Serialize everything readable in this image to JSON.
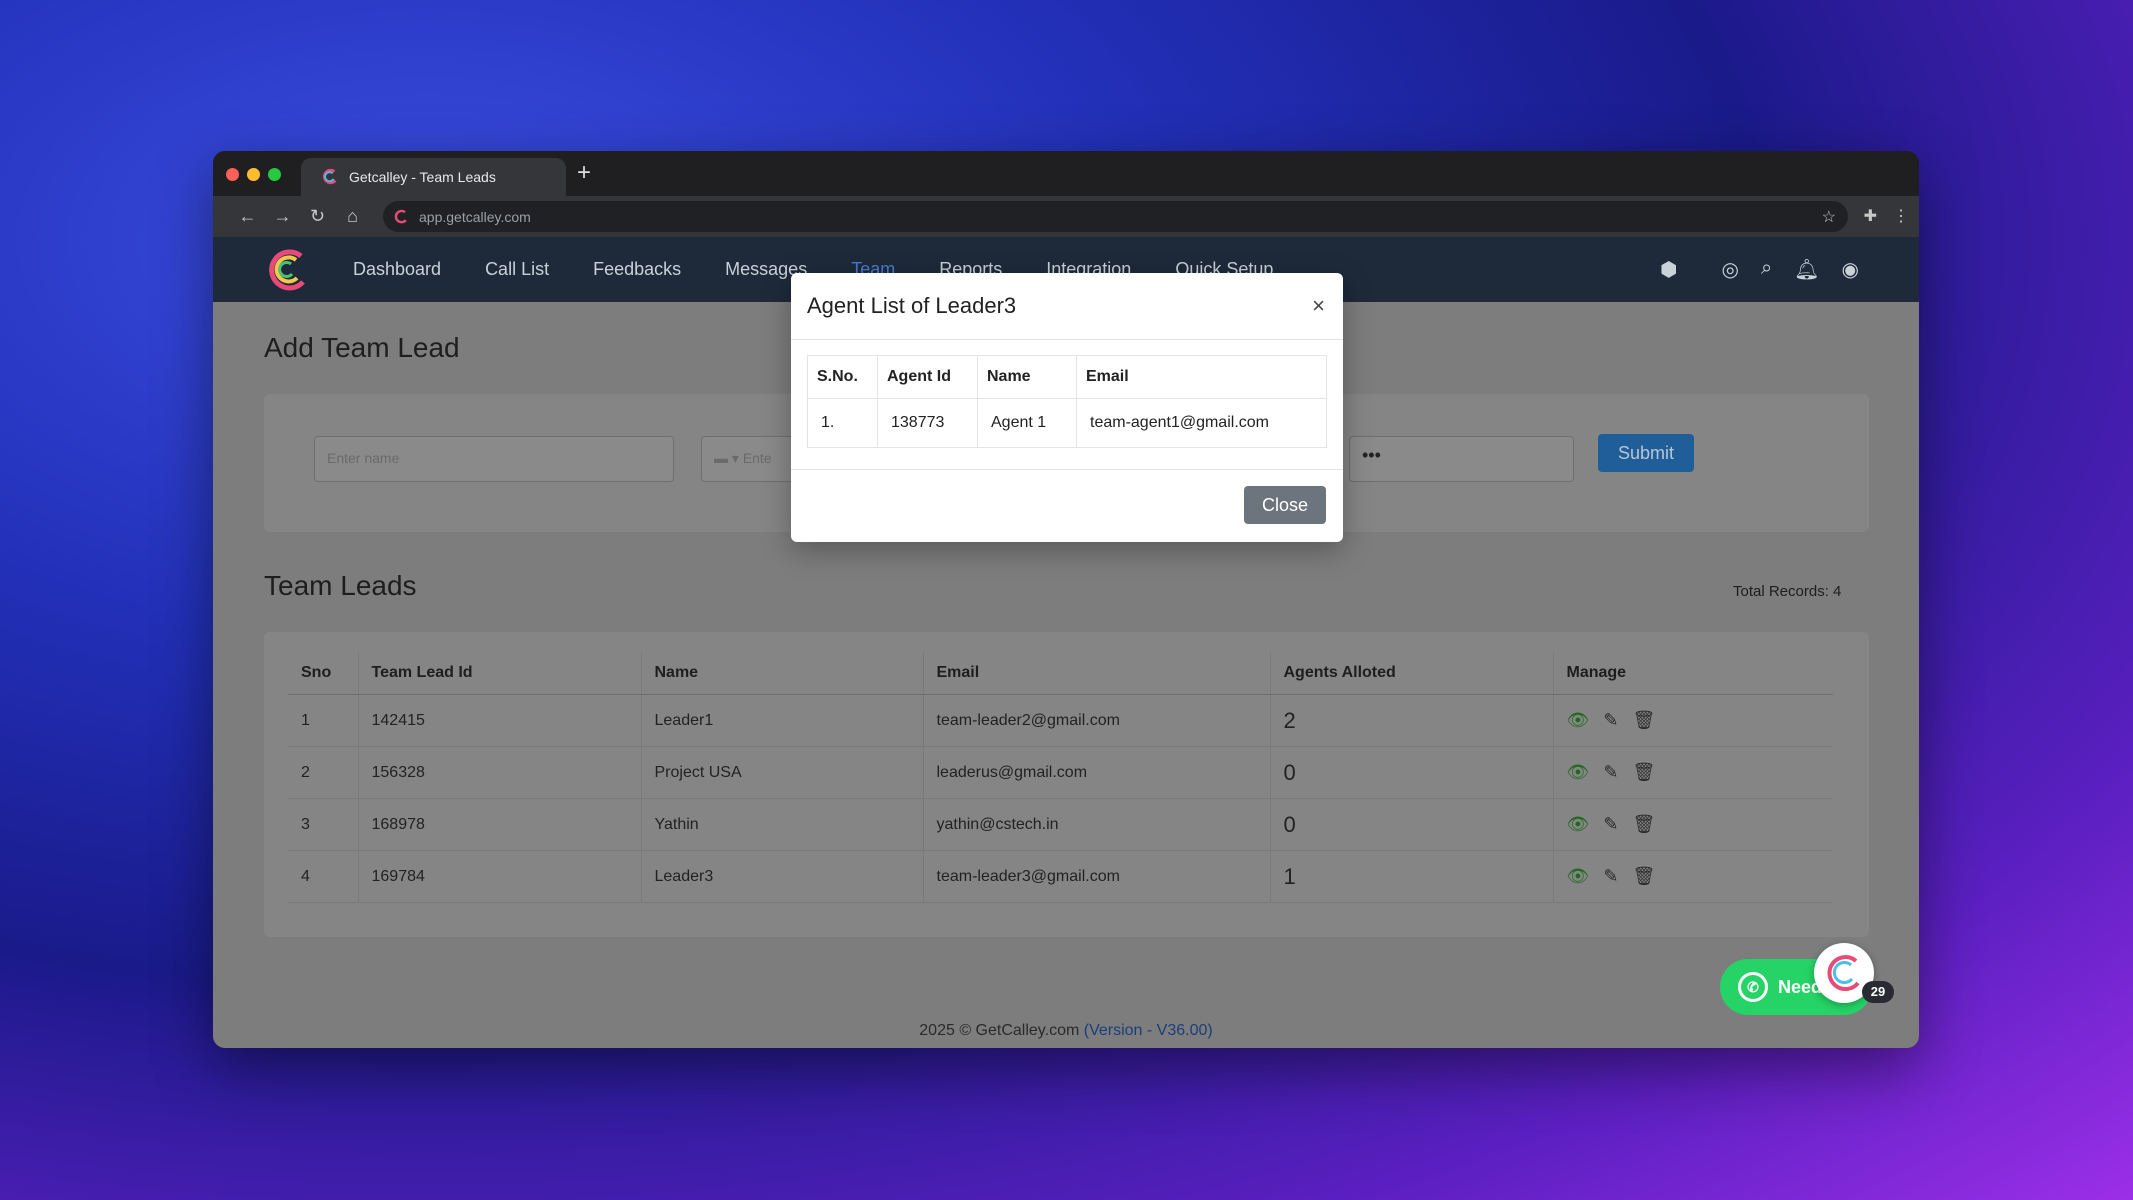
{
  "browser": {
    "tab_title": "Getcalley - Team Leads",
    "url": "app.getcalley.com"
  },
  "nav": {
    "links": [
      "Dashboard",
      "Call List",
      "Feedbacks",
      "Messages",
      "Team",
      "Reports",
      "Integration",
      "Quick Setup"
    ],
    "active_index": 4,
    "icons": [
      "android-icon",
      "apple-icon",
      "support-icon",
      "search-icon",
      "bell-icon",
      "user-icon"
    ]
  },
  "form": {
    "title": "Add Team Lead",
    "name_placeholder": "Enter name",
    "phone_placeholder": "Ente",
    "password_value": "•••",
    "submit_label": "Submit"
  },
  "team": {
    "title": "Team Leads",
    "total_records": "Total Records: 4",
    "columns": [
      "Sno",
      "Team Lead Id",
      "Name",
      "Email",
      "Agents Alloted",
      "Manage"
    ],
    "rows": [
      {
        "sno": "1",
        "id": "142415",
        "name": "Leader1",
        "email": "team-leader2@gmail.com",
        "agents": "2"
      },
      {
        "sno": "2",
        "id": "156328",
        "name": "Project USA",
        "email": "leaderus@gmail.com",
        "agents": "0"
      },
      {
        "sno": "3",
        "id": "168978",
        "name": "Yathin",
        "email": "yathin@cstech.in",
        "agents": "0"
      },
      {
        "sno": "4",
        "id": "169784",
        "name": "Leader3",
        "email": "team-leader3@gmail.com",
        "agents": "1"
      }
    ]
  },
  "footer": {
    "text": "2025 © GetCalley.com",
    "version": "(Version - V36.00)"
  },
  "modal": {
    "title": "Agent List of Leader3",
    "close_x": "×",
    "columns": [
      "S.No.",
      "Agent Id",
      "Name",
      "Email"
    ],
    "rows": [
      {
        "sno": "1.",
        "id": "138773",
        "name": "Agent 1",
        "email": "team-agent1@gmail.com"
      }
    ],
    "close_label": "Close"
  },
  "widget": {
    "label": "Need",
    "badge": "29"
  },
  "colors": {
    "accent": "#1f5e99",
    "nav_bg": "#1e2a3a",
    "whatsapp": "#25d366"
  }
}
